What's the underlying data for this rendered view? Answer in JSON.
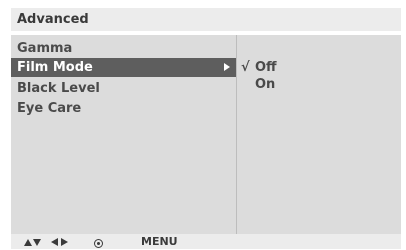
{
  "header": {
    "title": "Advanced"
  },
  "menu": {
    "items": [
      {
        "label": "Gamma",
        "selected": false
      },
      {
        "label": "Film Mode",
        "selected": true
      },
      {
        "label": "Black Level",
        "selected": false
      },
      {
        "label": "Eye Care",
        "selected": false
      }
    ]
  },
  "submenu": {
    "options": [
      {
        "label": "Off",
        "checked": true,
        "mark": "√"
      },
      {
        "label": "On",
        "checked": false,
        "mark": ""
      }
    ]
  },
  "footer": {
    "icons": [
      "up-down-arrows-icon",
      "left-right-arrows-icon",
      "ok-select-icon"
    ],
    "menu_label": "MENU"
  },
  "colors": {
    "highlight": "#5e5e5e",
    "panel": "#dcdcdc",
    "bar": "#ececec"
  }
}
